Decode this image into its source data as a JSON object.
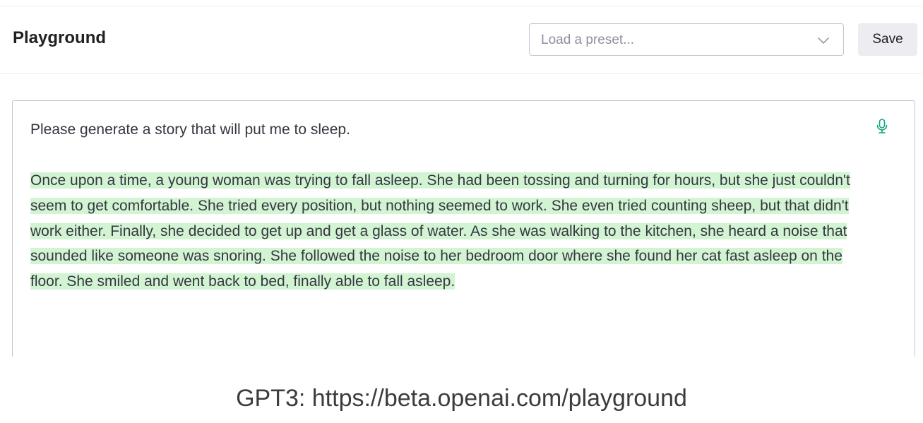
{
  "header": {
    "title": "Playground",
    "preset_placeholder": "Load a preset...",
    "save_label": "Save"
  },
  "editor": {
    "prompt": "Please generate a story that will put me to sleep.",
    "completion": "Once upon a time, a young woman was trying to fall asleep. She had been tossing and turning for hours, but she just couldn't seem to get comfortable. She tried every position, but nothing seemed to work. She even tried counting sheep, but that didn't work either. Finally, she decided to get up and get a glass of water. As she was walking to the kitchen, she heard a noise that sounded like someone was snoring. She followed the noise to her bedroom door where she found her cat fast asleep on the floor. She smiled and went back to bed, finally able to fall asleep."
  },
  "caption": "GPT3: https://beta.openai.com/playground",
  "icons": {
    "preset": "chevron-down-icon",
    "editor": "microphone-icon"
  },
  "colors": {
    "completion_highlight": "#d2f4d3",
    "mic_accent": "#10a37f",
    "save_bg": "#ececf1",
    "border": "#c5c5d2"
  }
}
